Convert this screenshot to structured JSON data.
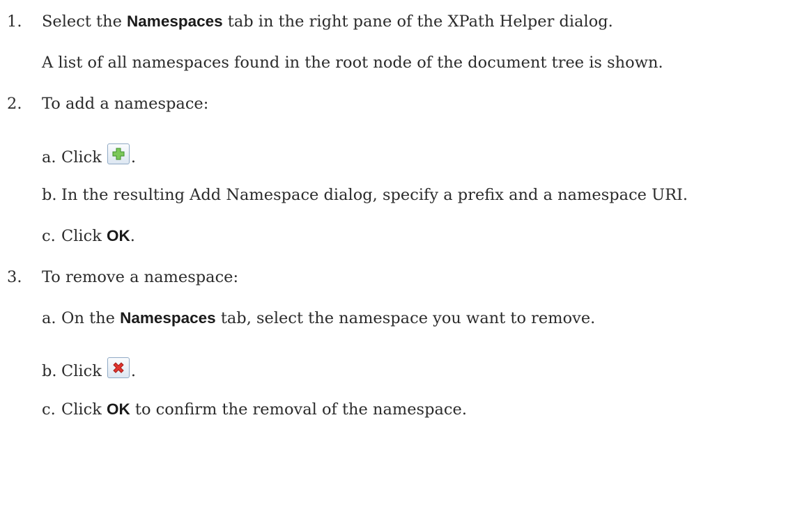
{
  "steps": [
    {
      "number": "1.",
      "text_before": "Select the ",
      "ui_term": "Namespaces",
      "text_after": " tab in the right pane of the XPath Helper dialog.",
      "note": "A list of all namespaces found in the root node of the document tree is shown."
    },
    {
      "number": "2.",
      "text": "To add a namespace:",
      "substeps": [
        {
          "letter": "a.",
          "text_before": "Click",
          "icon": "add-namespace-icon",
          "text_after": "."
        },
        {
          "letter": "b.",
          "text": "In the resulting Add Namespace dialog, specify a prefix and a namespace URI."
        },
        {
          "letter": "c.",
          "text_before": "Click ",
          "ui_term": "OK",
          "text_after": "."
        }
      ]
    },
    {
      "number": "3.",
      "text": "To remove a namespace:",
      "substeps": [
        {
          "letter": "a.",
          "text_before": "On the ",
          "ui_term": "Namespaces",
          "text_after": " tab, select the namespace you want to remove."
        },
        {
          "letter": "b.",
          "text_before": "Click",
          "icon": "remove-namespace-icon",
          "text_after": "."
        },
        {
          "letter": "c.",
          "text_before": "Click ",
          "ui_term": "OK",
          "text_after": " to confirm the removal of the namespace."
        }
      ]
    }
  ],
  "colors": {
    "text": "#2b2b2b",
    "add_icon": "#5cb85c",
    "remove_icon": "#e0352f",
    "icon_border": "#8fa9c4"
  }
}
